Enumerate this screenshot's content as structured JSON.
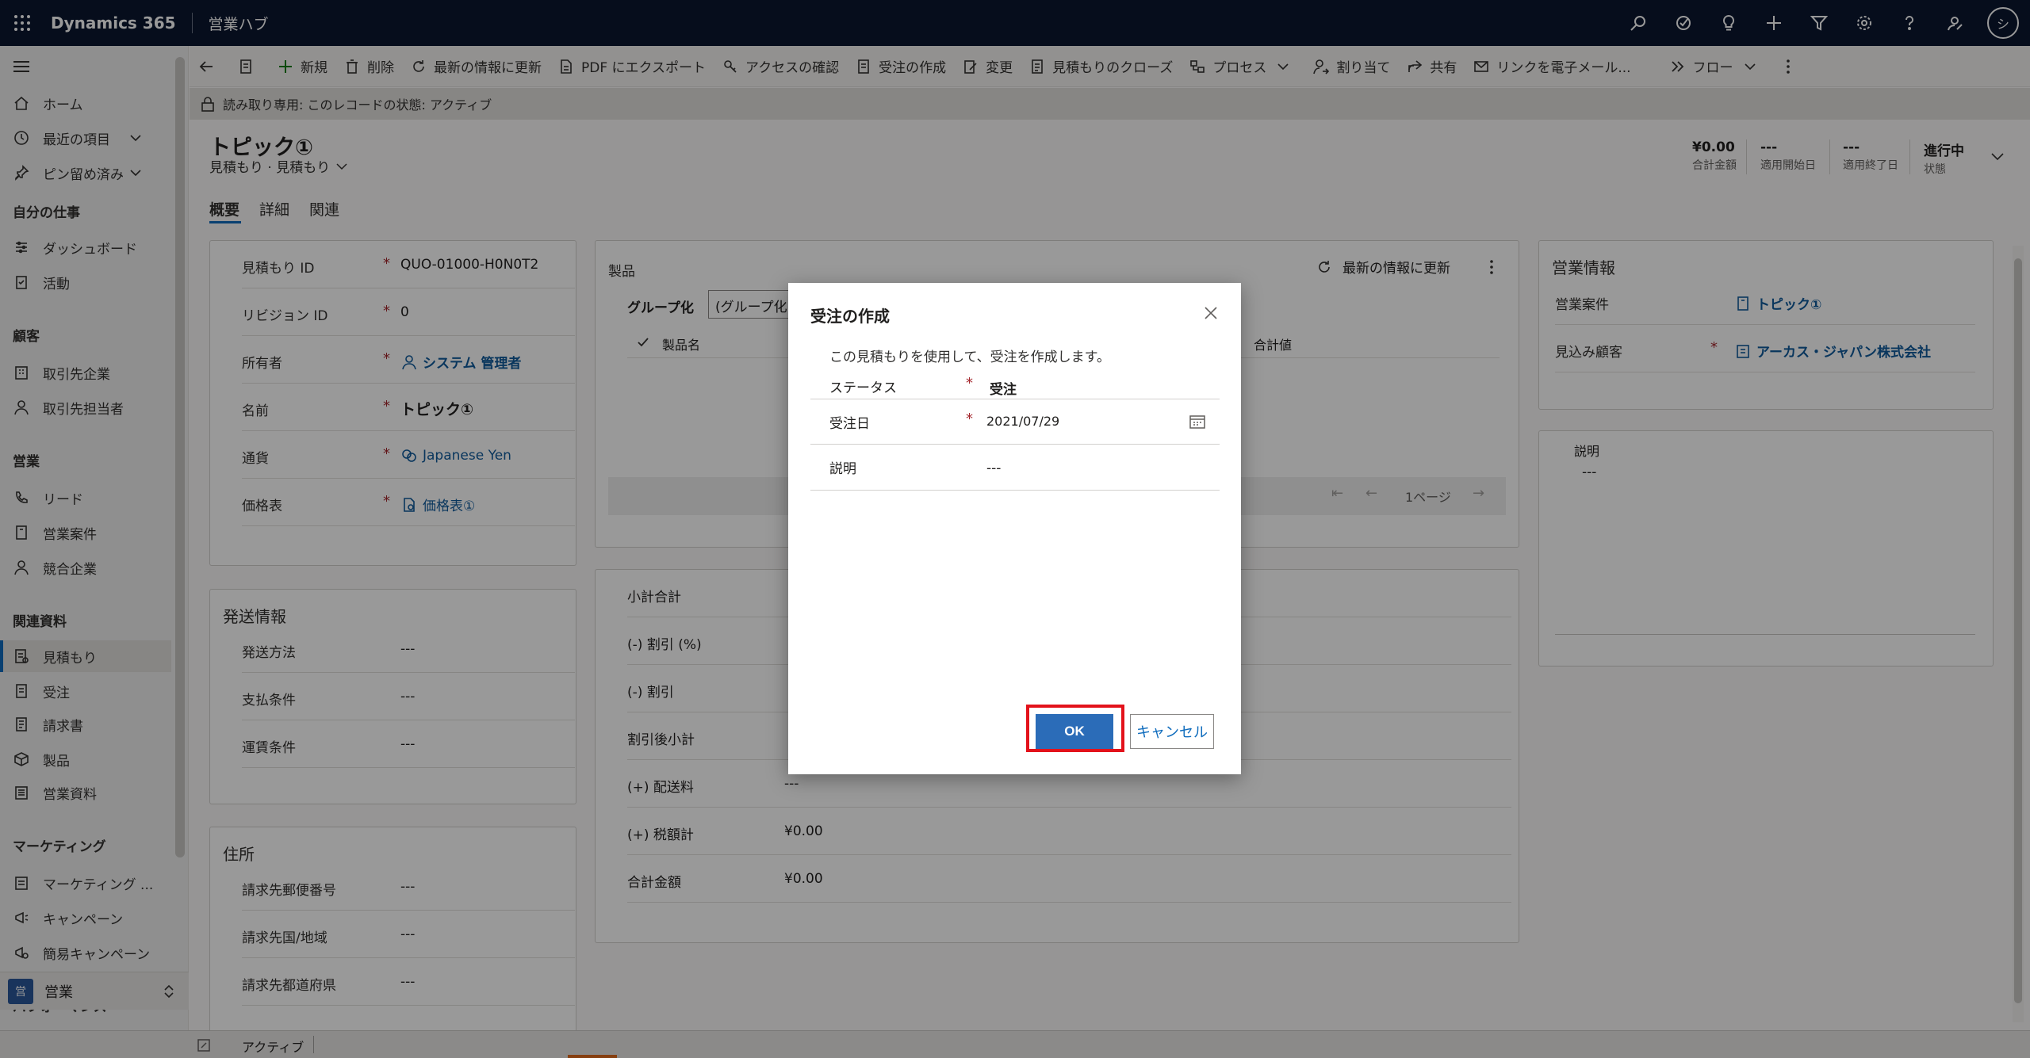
{
  "topbar": {
    "app_name": "Dynamics 365",
    "hub_name": "営業ハブ",
    "avatar_initial": "シ",
    "icons": [
      "search-icon",
      "task-icon",
      "lightbulb-icon",
      "plus-icon",
      "filter-icon",
      "gear-icon",
      "help-icon",
      "feedback-icon"
    ]
  },
  "sidebar": {
    "home": "ホーム",
    "recent": "最近の項目",
    "pinned": "ピン留め済み",
    "groups": {
      "my_work": "自分の仕事",
      "customers": "顧客",
      "sales": "営業",
      "collateral": "関連資料",
      "marketing": "マーケティング",
      "performance": "パフォーマンス"
    },
    "items": {
      "dashboard": "ダッシュボード",
      "activities": "活動",
      "accounts": "取引先企業",
      "contacts": "取引先担当者",
      "leads": "リード",
      "opportunities": "営業案件",
      "competitors": "競合企業",
      "quotes": "見積もり",
      "orders": "受注",
      "invoices": "請求書",
      "products": "製品",
      "sales_literature": "営業資料",
      "marketing_lists": "マーケティング ...",
      "campaigns": "キャンペーン",
      "quick_campaigns": "簡易キャンペーン"
    },
    "area": {
      "badge": "営",
      "label": "営業"
    }
  },
  "commands": {
    "new": "新規",
    "delete": "削除",
    "refresh": "最新の情報に更新",
    "export_pdf": "PDF にエクスポート",
    "check_access": "アクセスの確認",
    "create_order": "受注の作成",
    "revise": "変更",
    "close_quote": "見積もりのクローズ",
    "process": "プロセス",
    "assign": "割り当て",
    "share": "共有",
    "email_link": "リンクを電子メール...",
    "flow": "フロー"
  },
  "readonly_text": "読み取り専用: このレコードの状態: アクティブ",
  "record": {
    "title": "トピック①",
    "subtitle": "見積もり · 見積もり"
  },
  "header_fields": [
    {
      "value": "¥0.00",
      "label": "合計金額"
    },
    {
      "value": "---",
      "label": "適用開始日"
    },
    {
      "value": "---",
      "label": "適用終了日"
    },
    {
      "value": "進行中",
      "label": "状態"
    }
  ],
  "tabs": {
    "summary": "概要",
    "details": "詳細",
    "related": "関連"
  },
  "general": {
    "quote_id_label": "見積もり ID",
    "quote_id": "QUO-01000-H0N0T2",
    "revision_label": "リビジョン ID",
    "revision": "0",
    "owner_label": "所有者",
    "owner": "システム 管理者",
    "name_label": "名前",
    "name": "トピック①",
    "currency_label": "通貨",
    "currency": "Japanese Yen",
    "pricelist_label": "価格表",
    "pricelist": "価格表①"
  },
  "shipping": {
    "title": "発送情報",
    "method_label": "発送方法",
    "method": "---",
    "payment_label": "支払条件",
    "payment": "---",
    "freight_label": "運賃条件",
    "freight": "---"
  },
  "address": {
    "title": "住所",
    "zip_label": "請求先郵便番号",
    "zip": "---",
    "country_label": "請求先国/地域",
    "country": "---",
    "state_label": "請求先都道府県",
    "state": "---"
  },
  "products": {
    "title": "製品",
    "refresh": "最新の情報に更新",
    "group_label": "グループ化",
    "group_value": "(グループ化",
    "col_name": "製品名",
    "col_total": "合計値",
    "page": "1ページ"
  },
  "summary": {
    "subtotal_label": "小計合計",
    "discount_pct_label": "(-) 割引 (%)",
    "discount_label": "(-) 割引",
    "after_discount_label": "割引後小計",
    "shipping_label": "(+) 配送料",
    "shipping": "---",
    "tax_label": "(+) 税額計",
    "tax": "¥0.00",
    "total_label": "合計金額",
    "total": "¥0.00"
  },
  "sales_info": {
    "title": "営業情報",
    "opportunity_label": "営業案件",
    "opportunity": "トピック①",
    "prospect_label": "見込み顧客",
    "prospect": "アーカス・ジャパン株式会社",
    "description_label": "説明",
    "description": "---"
  },
  "dialog": {
    "title": "受注の作成",
    "description": "この見積もりを使用して、受注を作成します。",
    "status_label": "ステータス",
    "status": "受注",
    "date_label": "受注日",
    "date": "2021/07/29",
    "desc_label": "説明",
    "desc": "---",
    "ok": "OK",
    "cancel": "キャンセル"
  },
  "status_bar": {
    "state": "アクティブ"
  },
  "colors": {
    "topbar": "#0b1630",
    "accent": "#0f6cbd",
    "ok_button": "#2b6cb8",
    "highlight": "#e3121b",
    "required": "#a4262c"
  }
}
